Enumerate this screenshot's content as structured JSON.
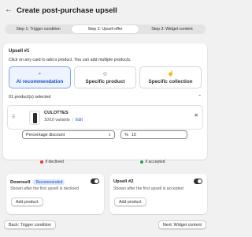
{
  "header": {
    "title": "Create post-purchase upsell",
    "back_icon": "arrow-left-icon"
  },
  "steps": [
    {
      "label": "Step 1: Trigger condition",
      "active": false
    },
    {
      "label": "Step 2: Upsell offer",
      "active": true
    },
    {
      "label": "Step 3: Widget content",
      "active": false
    }
  ],
  "upsell": {
    "title": "Upsell #1",
    "subtitle": "Click on any card to add a product. You can add multiple products.",
    "options": [
      {
        "label": "AI recommendation",
        "icon": "ai-search-icon",
        "selected": true
      },
      {
        "label": "Specific product",
        "icon": "tag-icon",
        "selected": false
      },
      {
        "label": "Specific collection",
        "icon": "collection-hand-icon",
        "selected": false
      }
    ],
    "selected_count": "01 product(s) selected",
    "product": {
      "name": "CULOTTES",
      "variants": "10/10 variants",
      "edit_label": "Edit"
    },
    "discount_type": "Percentage discount",
    "discount_prefix": "%",
    "discount_value": "10"
  },
  "branches": {
    "declined": {
      "label": "if declined",
      "color": "#e53935"
    },
    "accepted": {
      "label": "if accepted",
      "color": "#2e9e5b"
    }
  },
  "downsell": {
    "title": "Downsell",
    "badge": "Recommended",
    "description": "Shown after the first upsell is declined",
    "add_label": "Add product",
    "enabled": true
  },
  "upsell2": {
    "title": "Upsell #2",
    "description": "Shown after the first upsell is accepted",
    "add_label": "Add product",
    "enabled": true
  },
  "footer": {
    "back_label": "Back: Trigger condition",
    "next_label": "Next: Widget content"
  },
  "colors": {
    "accent": "#1c53c4",
    "selected_bg": "#eef4ff",
    "page_bg": "#f1f1f1"
  }
}
